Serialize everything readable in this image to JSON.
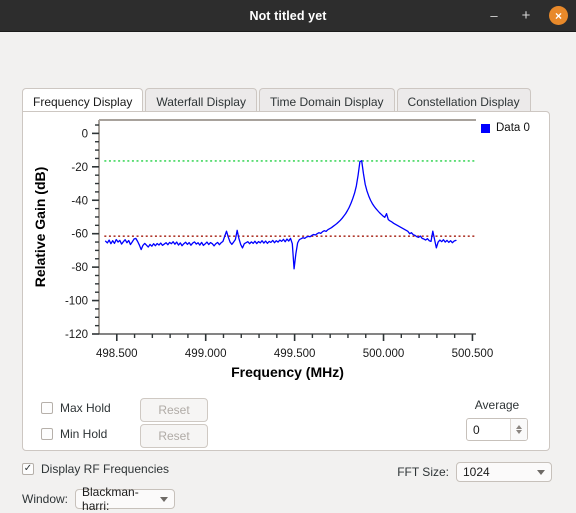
{
  "window": {
    "title": "Not titled yet",
    "buttons": {
      "minimize": "–",
      "maximize": "+",
      "close": "×"
    },
    "close_color": "#e8892a"
  },
  "tabs": [
    {
      "label": "Frequency Display",
      "active": true
    },
    {
      "label": "Waterfall Display",
      "active": false
    },
    {
      "label": "Time Domain Display",
      "active": false
    },
    {
      "label": "Constellation Display",
      "active": false
    }
  ],
  "controls": {
    "max_hold": {
      "label": "Max Hold",
      "checked": false,
      "mark": ""
    },
    "min_hold": {
      "label": "Min Hold",
      "checked": false,
      "mark": ""
    },
    "reset_max_label": "Reset",
    "reset_min_label": "Reset",
    "average": {
      "label": "Average",
      "value": "0"
    },
    "display_rf": {
      "label": "Display RF Frequencies",
      "checked": true,
      "mark": "✓"
    },
    "window": {
      "label": "Window:",
      "value": "Blackman-harri:"
    },
    "fft_size": {
      "label": "FFT Size:",
      "value": "1024"
    }
  },
  "chart_data": {
    "type": "line",
    "title": "",
    "xlabel": "Frequency (MHz)",
    "ylabel": "Relative Gain (dB)",
    "xlim": [
      498.4,
      500.52
    ],
    "ylim": [
      -120,
      8
    ],
    "xticks": [
      498.5,
      499.0,
      499.5,
      500.0,
      500.5
    ],
    "xticklabels": [
      "498.500",
      "499.000",
      "499.500",
      "500.000",
      "500.500"
    ],
    "yticks": [
      0,
      -20,
      -40,
      -60,
      -80,
      -100,
      -120
    ],
    "yticklabels": [
      "0",
      "-20",
      "-40",
      "-60",
      "-80",
      "-100",
      "-120"
    ],
    "grid": false,
    "legend": [
      {
        "name": "Data 0",
        "color": "#0000ff"
      }
    ],
    "reference_lines": [
      {
        "name": "max-hold-line",
        "y": -16.5,
        "color": "#44d861",
        "style": "dotted",
        "x_start": 498.43,
        "x_end": 500.52
      },
      {
        "name": "min-hold-line",
        "y": -61.5,
        "color": "#b03a2e",
        "style": "dotted",
        "x_start": 498.43,
        "x_end": 500.52
      }
    ],
    "series": [
      {
        "name": "Data 0",
        "color": "#0000ff",
        "x": [
          498.437,
          498.447,
          498.457,
          498.467,
          498.477,
          498.487,
          498.497,
          498.507,
          498.517,
          498.527,
          498.537,
          498.547,
          498.557,
          498.567,
          498.577,
          498.587,
          498.597,
          498.607,
          498.617,
          498.627,
          498.637,
          498.647,
          498.657,
          498.667,
          498.677,
          498.687,
          498.697,
          498.707,
          498.717,
          498.727,
          498.737,
          498.747,
          498.757,
          498.767,
          498.777,
          498.787,
          498.797,
          498.807,
          498.817,
          498.827,
          498.837,
          498.847,
          498.857,
          498.867,
          498.877,
          498.887,
          498.897,
          498.907,
          498.917,
          498.927,
          498.937,
          498.947,
          498.957,
          498.967,
          498.977,
          498.987,
          498.997,
          499.007,
          499.017,
          499.027,
          499.037,
          499.047,
          499.057,
          499.067,
          499.077,
          499.087,
          499.097,
          499.107,
          499.117,
          499.127,
          499.137,
          499.147,
          499.157,
          499.167,
          499.177,
          499.187,
          499.197,
          499.207,
          499.217,
          499.227,
          499.237,
          499.247,
          499.257,
          499.267,
          499.277,
          499.287,
          499.297,
          499.307,
          499.317,
          499.327,
          499.337,
          499.347,
          499.357,
          499.367,
          499.377,
          499.387,
          499.397,
          499.407,
          499.417,
          499.427,
          499.437,
          499.447,
          499.457,
          499.467,
          499.477,
          499.487,
          499.497,
          499.507,
          499.517,
          499.527,
          499.537,
          499.547,
          499.557,
          499.567,
          499.577,
          499.587,
          499.597,
          499.607,
          499.617,
          499.627,
          499.637,
          499.647,
          499.657,
          499.667,
          499.677,
          499.687,
          499.697,
          499.707,
          499.717,
          499.727,
          499.737,
          499.747,
          499.757,
          499.767,
          499.777,
          499.787,
          499.797,
          499.807,
          499.817,
          499.827,
          499.837,
          499.847,
          499.857,
          499.867,
          499.877,
          499.887,
          499.897,
          499.907,
          499.917,
          499.927,
          499.937,
          499.947,
          499.957,
          499.967,
          499.977,
          499.987,
          499.997,
          500.007,
          500.017,
          500.027,
          500.037,
          500.047,
          500.057,
          500.067,
          500.077,
          500.087,
          500.097,
          500.107,
          500.117,
          500.127,
          500.137,
          500.147,
          500.157,
          500.167,
          500.177,
          500.187,
          500.197,
          500.207,
          500.217,
          500.227,
          500.237,
          500.247,
          500.257,
          500.267,
          500.277,
          500.287,
          500.297,
          500.307,
          500.317,
          500.327,
          500.337,
          500.347,
          500.357,
          500.367,
          500.377,
          500.387,
          500.397,
          500.407
        ],
        "y": [
          -64.5,
          -65.5,
          -63.8,
          -66.0,
          -64.2,
          -65.8,
          -63.5,
          -65.0,
          -64.0,
          -66.2,
          -64.8,
          -63.6,
          -65.4,
          -64.1,
          -66.5,
          -64.9,
          -63.2,
          -62.8,
          -64.6,
          -66.8,
          -69.5,
          -67.0,
          -65.8,
          -66.9,
          -68.0,
          -66.4,
          -67.5,
          -66.0,
          -67.2,
          -65.9,
          -66.8,
          -65.6,
          -67.0,
          -66.2,
          -65.4,
          -66.6,
          -65.2,
          -66.0,
          -64.8,
          -66.3,
          -65.0,
          -66.8,
          -65.5,
          -67.2,
          -66.0,
          -65.1,
          -66.4,
          -65.3,
          -66.9,
          -65.6,
          -64.9,
          -66.2,
          -65.4,
          -66.8,
          -65.2,
          -67.0,
          -66.1,
          -65.0,
          -66.5,
          -65.3,
          -66.0,
          -67.3,
          -66.0,
          -65.2,
          -66.6,
          -65.4,
          -64.6,
          -61.5,
          -58.5,
          -62.0,
          -65.0,
          -66.4,
          -65.0,
          -63.5,
          -58.0,
          -63.0,
          -66.5,
          -68.5,
          -66.0,
          -65.4,
          -64.8,
          -66.0,
          -64.9,
          -65.8,
          -64.5,
          -65.9,
          -64.7,
          -65.5,
          -64.2,
          -65.6,
          -64.4,
          -65.8,
          -64.6,
          -65.2,
          -64.0,
          -65.4,
          -64.2,
          -65.0,
          -63.8,
          -64.6,
          -63.4,
          -64.8,
          -63.2,
          -64.4,
          -62.8,
          -66.0,
          -81.0,
          -72.0,
          -65.5,
          -63.5,
          -63.0,
          -62.4,
          -62.8,
          -62.0,
          -61.6,
          -61.8,
          -61.0,
          -60.5,
          -60.8,
          -60.0,
          -59.4,
          -59.8,
          -58.8,
          -58.2,
          -58.6,
          -57.6,
          -57.0,
          -56.4,
          -55.6,
          -54.8,
          -54.0,
          -53.0,
          -52.0,
          -50.8,
          -49.4,
          -48.0,
          -46.2,
          -44.2,
          -41.8,
          -39.0,
          -35.8,
          -31.5,
          -25.0,
          -17.0,
          -16.3,
          -24.0,
          -30.5,
          -34.5,
          -37.5,
          -40.0,
          -42.0,
          -43.6,
          -45.0,
          -46.2,
          -47.4,
          -48.4,
          -49.4,
          -50.2,
          -48.0,
          -51.6,
          -52.4,
          -53.0,
          -53.8,
          -54.4,
          -55.0,
          -55.6,
          -56.2,
          -56.8,
          -57.4,
          -58.0,
          -58.6,
          -60.0,
          -59.4,
          -60.6,
          -61.0,
          -61.8,
          -62.2,
          -61.4,
          -62.8,
          -63.2,
          -63.8,
          -63.0,
          -64.2,
          -64.6,
          -58.5,
          -63.5,
          -68.5,
          -65.0,
          -63.8,
          -64.8,
          -63.6,
          -65.0,
          -64.0,
          -65.2,
          -64.2,
          -65.4,
          -64.4,
          -64.0
        ]
      }
    ]
  }
}
